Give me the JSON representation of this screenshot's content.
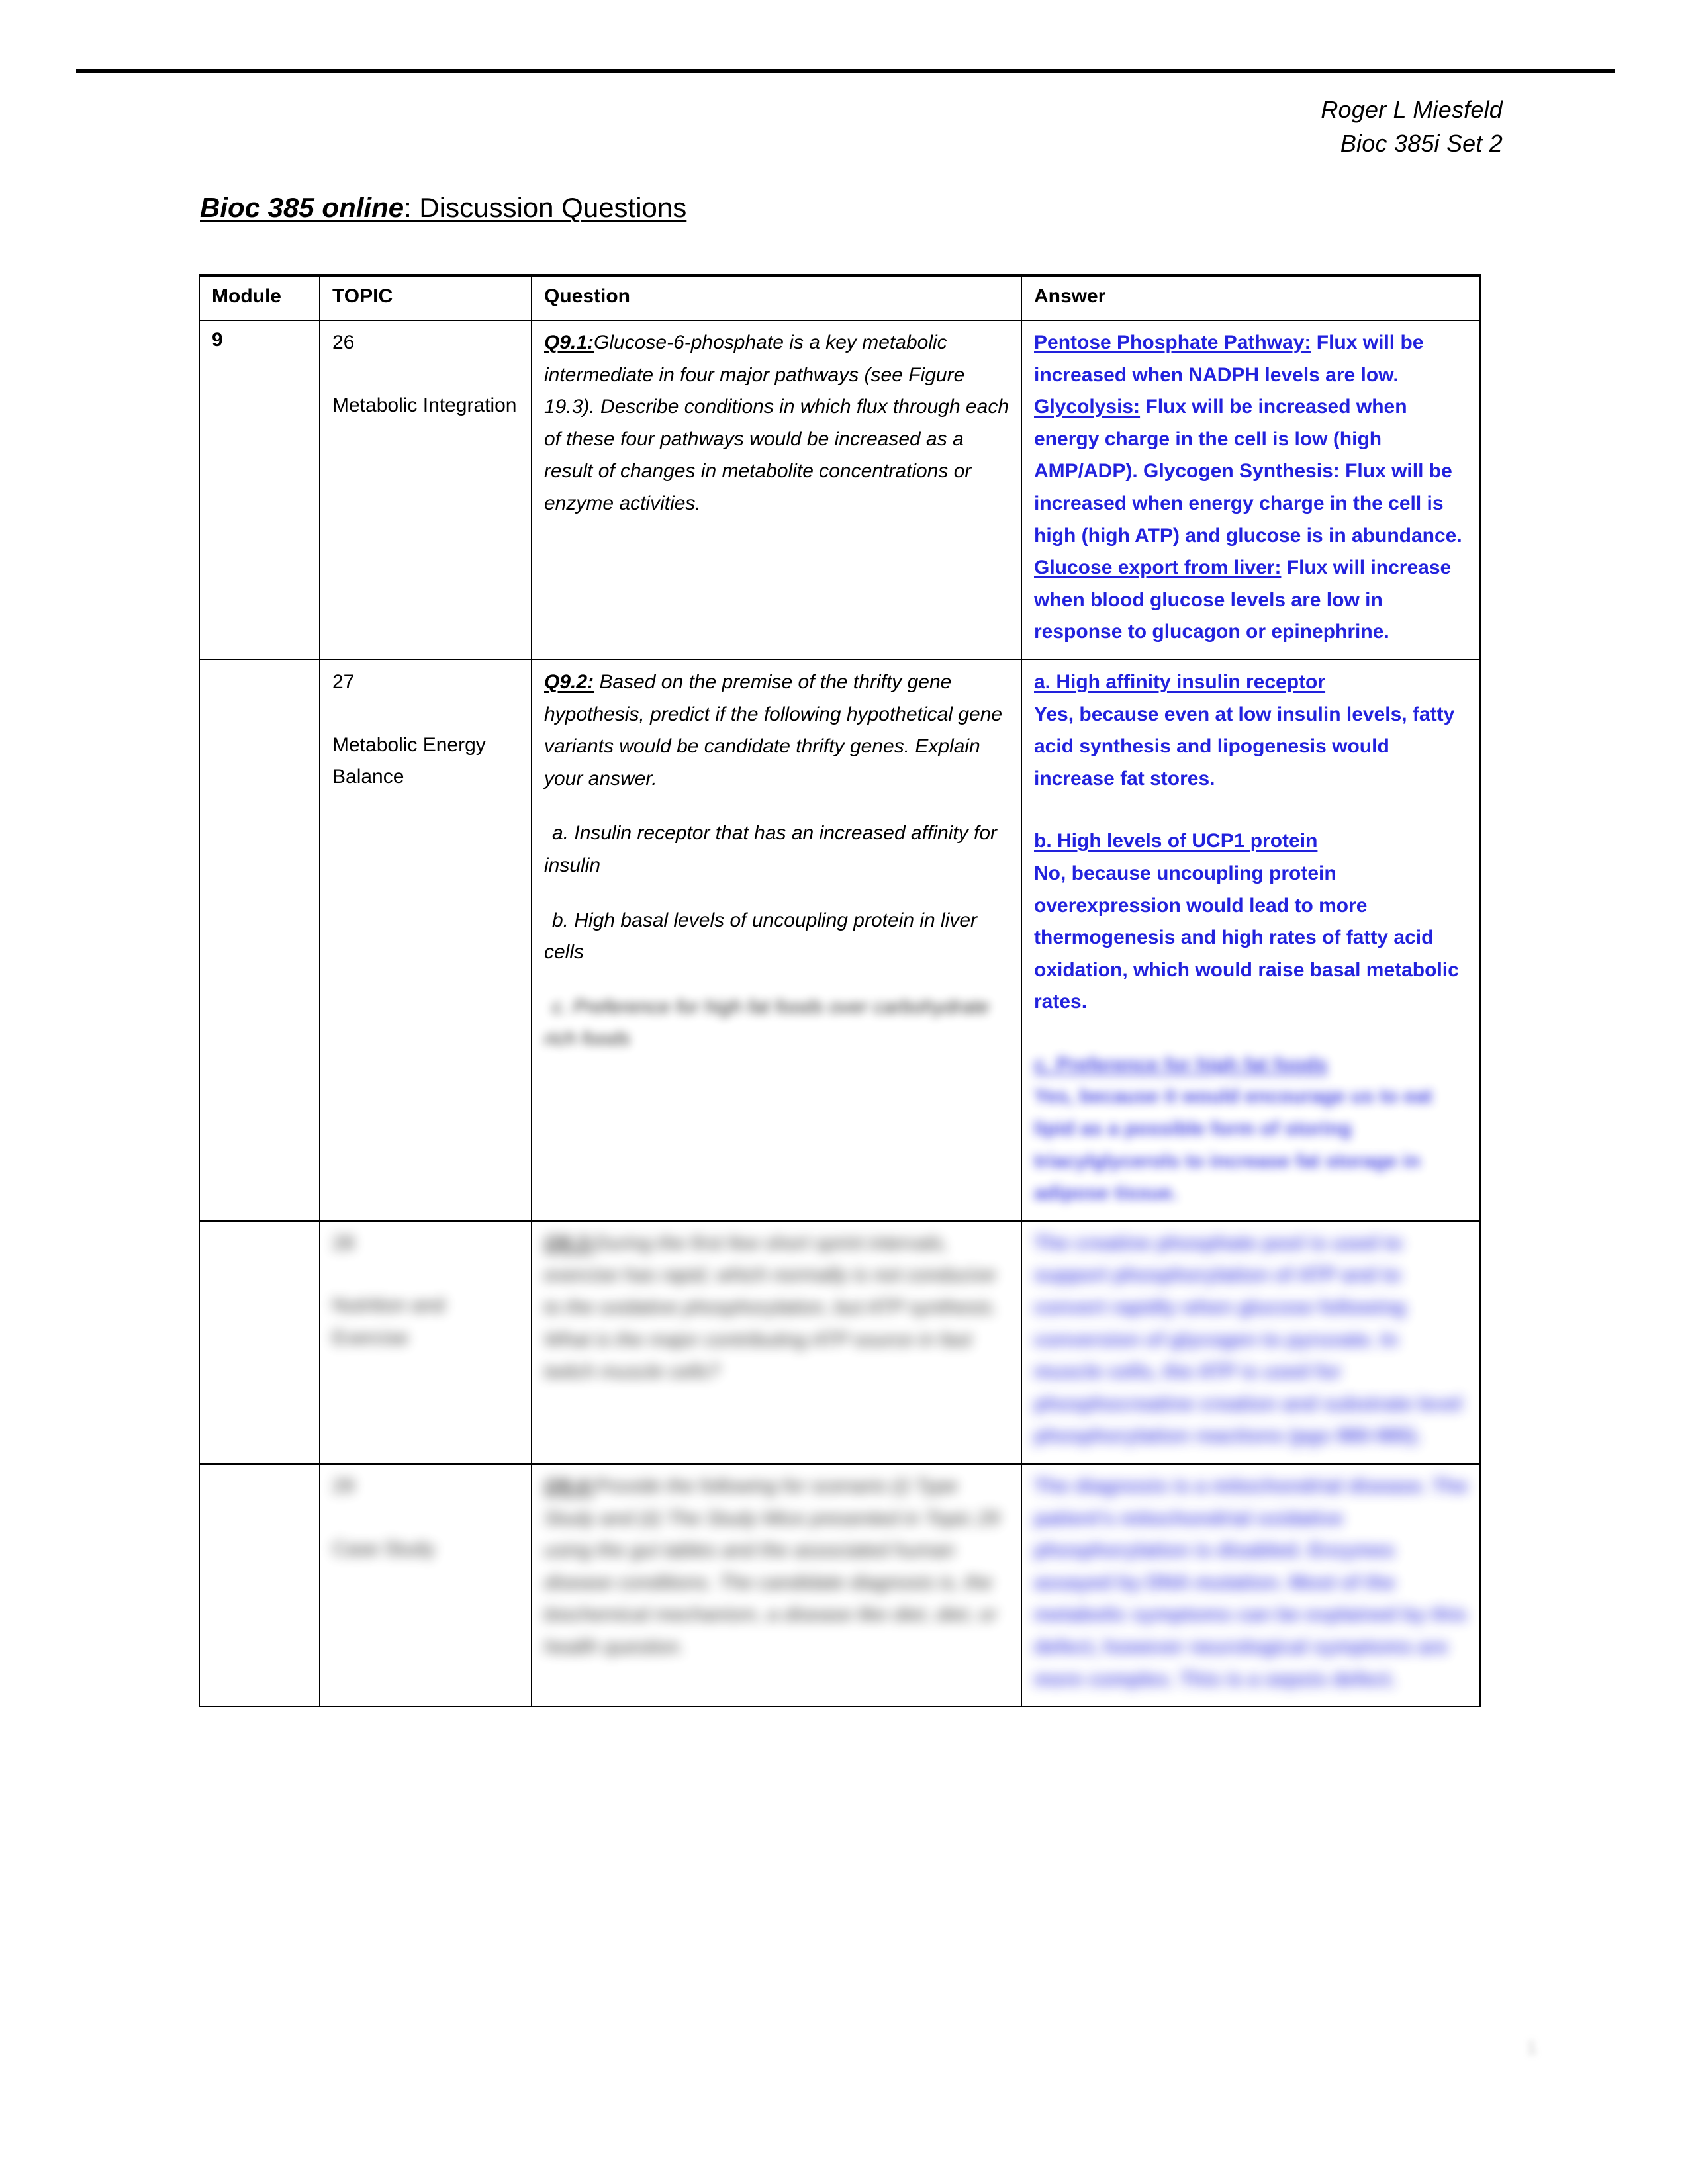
{
  "header": {
    "author": "Roger L Miesfeld",
    "course": "Bioc 385i Set 2"
  },
  "title": {
    "emphasis": "Bioc 385 online",
    "rest": ": Discussion Questions"
  },
  "table": {
    "columns": [
      "Module",
      "TOPIC",
      "Question",
      "Answer"
    ],
    "rows": [
      {
        "module": "9",
        "topic_number": "26",
        "topic_name": "Metabolic Integration",
        "question_label": "Q9.1:",
        "question_text": "Glucose-6-phosphate is a key metabolic intermediate in four major pathways (see Figure 19.3).  Describe conditions in which flux through each of these four pathways would be increased as a result of changes in metabolite concentrations or enzyme activities.",
        "question_subitems": [],
        "answer_blocks": [
          {
            "heading": "Pentose Phosphate Pathway:",
            "text": " Flux will be increased when NADPH levels are low. ",
            "heading2": "Glycolysis:",
            "text2": " Flux will be increased when energy charge in the cell is low (high AMP/ADP). Glycogen Synthesis: Flux will be increased when energy charge in the cell is high (high ATP) and glucose is in abundance. ",
            "heading3": "Glucose export from liver:",
            "text3": " Flux will increase when blood glucose levels are low in response to glucagon or epinephrine."
          }
        ],
        "blurred": false
      },
      {
        "module": "",
        "topic_number": "27",
        "topic_name": "Metabolic Energy Balance",
        "question_label": "Q9.2:",
        "question_text": " Based on the premise of the thrifty gene hypothesis, predict if the following hypothetical gene variants would be candidate thrifty genes. Explain your answer.",
        "question_subitems": [
          " a. Insulin receptor that has an increased affinity for insulin",
          " b. High basal levels of uncoupling protein in liver cells",
          " c. Preference for high fat foods over carbohydrate rich foods"
        ],
        "answer_blocks": [
          {
            "heading": "a. High affinity insulin receptor",
            "text": "Yes, because even at low insulin levels, fatty acid synthesis and lipogenesis would increase fat stores."
          },
          {
            "heading": "b. High levels of UCP1 protein",
            "text": "No, because uncoupling protein overexpression would lead to more thermogenesis and high rates of fatty acid oxidation, which would raise basal metabolic rates."
          },
          {
            "heading": "c. Preference for high fat foods",
            "text": "Yes, because it would encourage us to eat lipid as a possible form of storing triacylglycerols to increase fat storage in adipose tissue."
          }
        ],
        "blurred": true
      },
      {
        "module": "",
        "topic_number": "28",
        "topic_name": "Nutrition and Exercise",
        "question_label": "Q9.3:",
        "question_text": "During the first few short sprint intervals, exercise has rapid, which normally is not conducive to the oxidative phosphorylation, but ATP synthesis.  What is the major contributing ATP source in fast twitch muscle cells?",
        "question_subitems": [],
        "answer_blocks": [
          {
            "heading": "",
            "text": "The creatine phosphate pool is used to support phosphorylation of ATP and to convert rapidly when glucose following conversion of glycogen to pyruvate.  In muscle cells, the ATP is used for phosphocreatine creation and substrate level phosphorylation reactions (pgs 980-985)."
          }
        ],
        "blurred": true
      },
      {
        "module": "",
        "topic_number": "29",
        "topic_name": "Case Study",
        "question_label": "Q9.4:",
        "question_text": "Provide the following for scenario (i) Type Study and (ii) The Study Mice presented in Topic 29 using the gut tables and the associated human disease conditions.  The candidate diagnosis is, the biochemical mechanism, a disease like diet, diet, or health question.",
        "question_subitems": [],
        "answer_blocks": [
          {
            "heading": "",
            "text": "The diagnosis is a mitochondrial disease. The patient's mitochondrial oxidative phosphorylation is disabled. Enzymes assayed by DNA mutation. Most of the metabolic symptoms can be explained by this defect, however neurological symptoms are more complex. This is a sepsis defect."
          }
        ],
        "blurred": true
      }
    ]
  },
  "page_number": "1"
}
